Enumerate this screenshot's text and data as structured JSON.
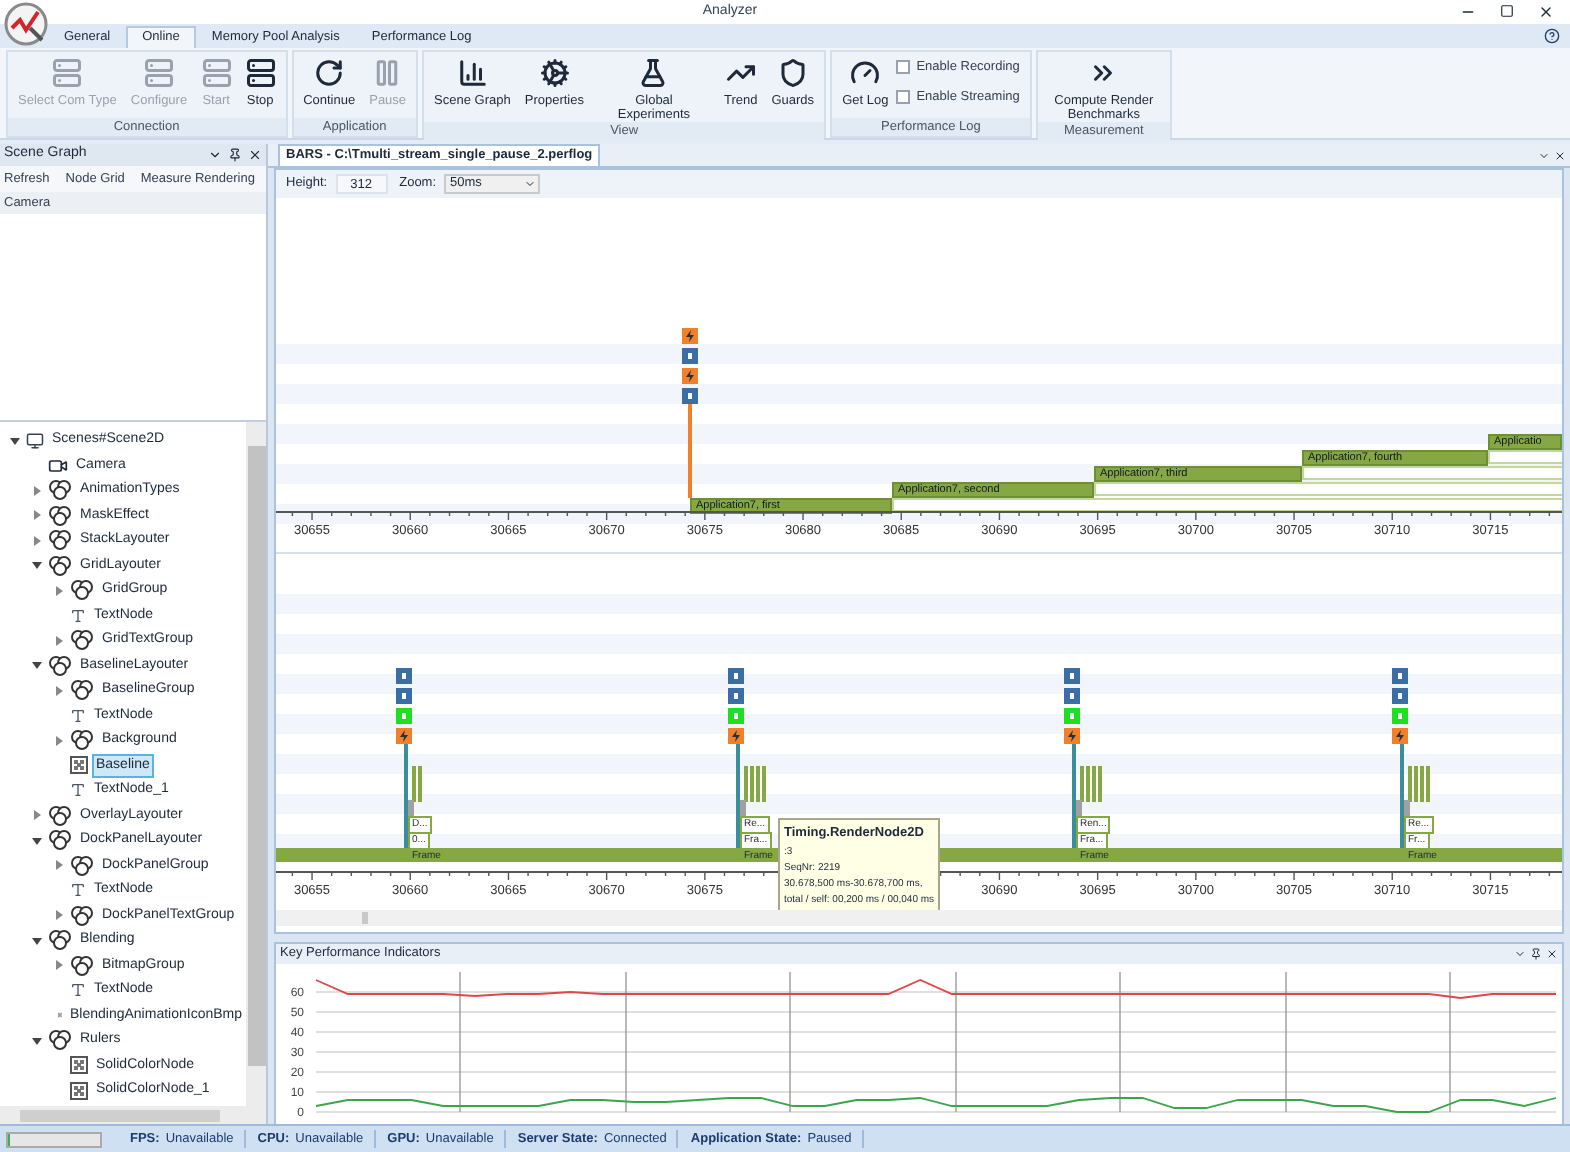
{
  "window": {
    "title": "Analyzer"
  },
  "tabs": [
    {
      "label": "General",
      "selected": false
    },
    {
      "label": "Online",
      "selected": true
    },
    {
      "label": "Memory Pool Analysis",
      "selected": false
    },
    {
      "label": "Performance Log",
      "selected": false
    }
  ],
  "ribbon": [
    {
      "title": "Connection",
      "items": [
        {
          "kind": "button",
          "label": "Select Com Type",
          "disabled": true
        },
        {
          "kind": "button",
          "label": "Configure",
          "disabled": true
        },
        {
          "kind": "button",
          "label": "Start",
          "disabled": true
        },
        {
          "kind": "button",
          "label": "Stop",
          "disabled": false
        }
      ]
    },
    {
      "title": "Application",
      "items": [
        {
          "kind": "button",
          "label": "Continue",
          "disabled": false
        },
        {
          "kind": "button",
          "label": "Pause",
          "disabled": true
        }
      ]
    },
    {
      "title": "View",
      "items": [
        {
          "kind": "button",
          "label": "Scene Graph",
          "disabled": false
        },
        {
          "kind": "button",
          "label": "Properties",
          "disabled": false
        },
        {
          "kind": "button",
          "label": "Global Experiments",
          "disabled": false
        },
        {
          "kind": "button",
          "label": "Trend",
          "disabled": false
        },
        {
          "kind": "button",
          "label": "Guards",
          "disabled": false
        }
      ]
    },
    {
      "title": "Performance Log",
      "items": [
        {
          "kind": "button",
          "label": "Get Log",
          "disabled": false
        },
        {
          "kind": "checkbox",
          "label": "Enable Recording",
          "checked": false
        },
        {
          "kind": "checkbox",
          "label": "Enable Streaming",
          "checked": false
        }
      ]
    },
    {
      "title": "Measurement",
      "items": [
        {
          "kind": "button",
          "label": "Compute Render Benchmarks",
          "disabled": false
        }
      ]
    }
  ],
  "scene_graph": {
    "title": "Scene Graph",
    "toolbar": [
      "Refresh",
      "Node Grid",
      "Measure Rendering"
    ],
    "property_header": "Camera",
    "tree": [
      {
        "label": "Scenes#Scene2D",
        "kind": "scene",
        "expanded": true,
        "selected": false,
        "children": [
          {
            "label": "Camera",
            "kind": "camera",
            "selected": false
          },
          {
            "label": "AnimationTypes",
            "kind": "group",
            "expanded": false,
            "selected": false
          },
          {
            "label": "MaskEffect",
            "kind": "group",
            "expanded": false,
            "selected": false
          },
          {
            "label": "StackLayouter",
            "kind": "group",
            "expanded": false,
            "selected": false
          },
          {
            "label": "GridLayouter",
            "kind": "group",
            "expanded": true,
            "selected": false,
            "children": [
              {
                "label": "GridGroup",
                "kind": "group",
                "expanded": false,
                "selected": false
              },
              {
                "label": "TextNode",
                "kind": "text",
                "selected": false
              },
              {
                "label": "GridTextGroup",
                "kind": "group",
                "expanded": false,
                "selected": false
              }
            ]
          },
          {
            "label": "BaselineLayouter",
            "kind": "group",
            "expanded": true,
            "selected": false,
            "children": [
              {
                "label": "BaselineGroup",
                "kind": "group",
                "expanded": false,
                "selected": false
              },
              {
                "label": "TextNode",
                "kind": "text",
                "selected": false
              },
              {
                "label": "Background",
                "kind": "group",
                "expanded": false,
                "selected": false
              },
              {
                "label": "Baseline",
                "kind": "bitmap",
                "selected": true
              },
              {
                "label": "TextNode_1",
                "kind": "text",
                "selected": false
              }
            ]
          },
          {
            "label": "OverlayLayouter",
            "kind": "group",
            "expanded": false,
            "selected": false
          },
          {
            "label": "DockPanelLayouter",
            "kind": "group",
            "expanded": true,
            "selected": false,
            "children": [
              {
                "label": "DockPanelGroup",
                "kind": "group",
                "expanded": false,
                "selected": false
              },
              {
                "label": "TextNode",
                "kind": "text",
                "selected": false
              },
              {
                "label": "DockPanelTextGroup",
                "kind": "group",
                "expanded": false,
                "selected": false
              }
            ]
          },
          {
            "label": "Blending",
            "kind": "group",
            "expanded": true,
            "selected": false,
            "children": [
              {
                "label": "BitmapGroup",
                "kind": "group",
                "expanded": false,
                "selected": false
              },
              {
                "label": "TextNode",
                "kind": "text",
                "selected": false
              },
              {
                "label": "BlendingAnimationIconBmp",
                "kind": "bitmap",
                "selected": false
              }
            ]
          },
          {
            "label": "Rulers",
            "kind": "group",
            "expanded": true,
            "selected": false,
            "children": [
              {
                "label": "SolidColorNode",
                "kind": "bitmap",
                "selected": false
              },
              {
                "label": "SolidColorNode_1",
                "kind": "bitmap",
                "selected": false
              }
            ]
          }
        ]
      }
    ]
  },
  "document": {
    "tab": "BARS - C:\\Tmulti_stream_single_pause_2.perflog",
    "height_label": "Height:",
    "height_value": "312",
    "zoom_label": "Zoom:",
    "zoom_value": "50ms"
  },
  "top_timeline": {
    "axis": [
      "30655",
      "30660",
      "30665",
      "30670",
      "30675",
      "30680",
      "30685",
      "30690",
      "30695",
      "30700",
      "30705",
      "30710",
      "30715"
    ],
    "bars": [
      "Application7, first",
      "Application7, second",
      "Application7, third",
      "Application7, fourth",
      "Applicatio"
    ]
  },
  "bottom_timeline": {
    "axis_before_tooltip": [
      "30655",
      "30660",
      "30665",
      "30670",
      "30675"
    ],
    "axis_after_tooltip": [
      "30690",
      "30695",
      "30700",
      "30705",
      "30710",
      "30715"
    ],
    "frames": [
      {
        "labels": [
          "D...",
          "0...",
          "Frame"
        ]
      },
      {
        "labels": [
          "Re...",
          "Fra...",
          "Frame"
        ]
      },
      {
        "labels": [
          "Ren...",
          "Fra...",
          "Frame"
        ]
      },
      {
        "labels": [
          "Re...",
          "Fr...",
          "Frame"
        ]
      }
    ],
    "tooltip": {
      "title": "Timing.RenderNode2D",
      "lines": [
        ":3",
        "SeqNr: 2219",
        "30.678,500 ms-30.678,700 ms,",
        "total / self: 00,200 ms / 00,040 ms"
      ]
    }
  },
  "kpi": {
    "title": "Key Performance Indicators",
    "chart_data": {
      "type": "line",
      "grid": true,
      "ylim": [
        0,
        70
      ],
      "yticks": [
        0,
        10,
        20,
        30,
        40,
        50,
        60
      ],
      "series": [
        {
          "color": "#e0454a",
          "values": [
            66,
            59,
            59,
            59,
            59,
            58,
            59,
            59,
            60,
            59,
            59,
            59,
            59,
            59,
            59,
            59,
            59,
            59,
            59,
            66,
            59,
            59,
            59,
            59,
            59,
            59,
            59,
            59,
            59,
            59,
            59,
            59,
            59,
            59,
            59,
            59,
            57,
            59,
            59,
            59
          ]
        },
        {
          "color": "#3aa64a",
          "values": [
            3,
            6,
            6,
            6,
            3,
            3,
            3,
            3,
            6,
            6,
            5,
            5,
            6,
            7,
            7,
            3,
            3,
            6,
            6,
            7,
            3,
            3,
            3,
            3,
            6,
            7,
            7,
            2,
            2,
            6,
            6,
            6,
            3,
            3,
            0,
            0,
            6,
            6,
            3,
            7
          ]
        }
      ]
    }
  },
  "status_bar": {
    "progress": {
      "level": 0.02
    },
    "items": [
      {
        "label": "FPS:",
        "value": "Unavailable"
      },
      {
        "label": "CPU:",
        "value": "Unavailable"
      },
      {
        "label": "GPU:",
        "value": "Unavailable"
      },
      {
        "label": "Server State:",
        "value": "Connected"
      },
      {
        "label": "Application State:",
        "value": "Paused"
      }
    ]
  }
}
